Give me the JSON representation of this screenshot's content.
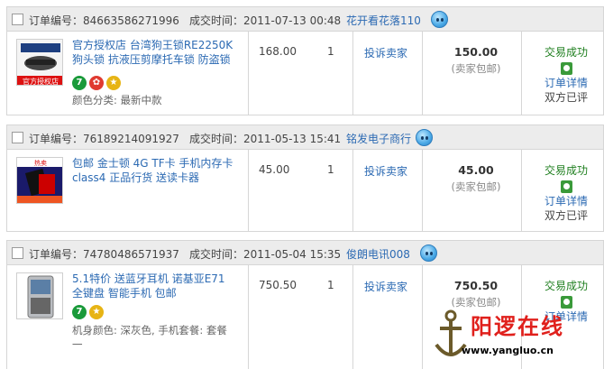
{
  "labels": {
    "order_no": "订单编号：",
    "deal_time": "成交时间：",
    "complaint": "投诉卖家",
    "shipping": "(卖家包邮)",
    "status": "交易成功",
    "detail": "订单详情",
    "rated": "双方已评"
  },
  "orders": [
    {
      "order_no": "84663586271996",
      "deal_time": "2011-07-13 00:48",
      "seller": "花开看花落110",
      "title": "官方授权店 台湾狗王锁RE2250K 狗头锁 抗液压剪摩托车锁 防盗锁",
      "meta": "颜色分类: 最新中款",
      "unit_price": "168.00",
      "qty": "1",
      "total": "150.00",
      "thumb_label": "官方授权店"
    },
    {
      "order_no": "76189214091927",
      "deal_time": "2011-05-13 15:41",
      "seller": "铭发电子商行",
      "title": "包邮 金士顿 4G TF卡 手机内存卡 class4 正品行货 送读卡器",
      "meta": "",
      "unit_price": "45.00",
      "qty": "1",
      "total": "45.00",
      "thumb_label": "热卖"
    },
    {
      "order_no": "74780486571937",
      "deal_time": "2011-05-04 15:35",
      "seller": "俊朗电讯008",
      "title": "5.1特价 送蓝牙耳机 诺基亚E71 全键盘 智能手机 包邮",
      "meta": "机身颜色: 深灰色, 手机套餐: 套餐一",
      "unit_price": "750.50",
      "qty": "1",
      "total": "750.50",
      "thumb_label": ""
    }
  ],
  "watermark": {
    "title": "阳逻在线",
    "url": "www.yangluo.cn"
  },
  "colors": {
    "link": "#2c6ab3",
    "success": "#1f7f1f",
    "header_bg": "#ececec",
    "border": "#d6d6d6"
  }
}
